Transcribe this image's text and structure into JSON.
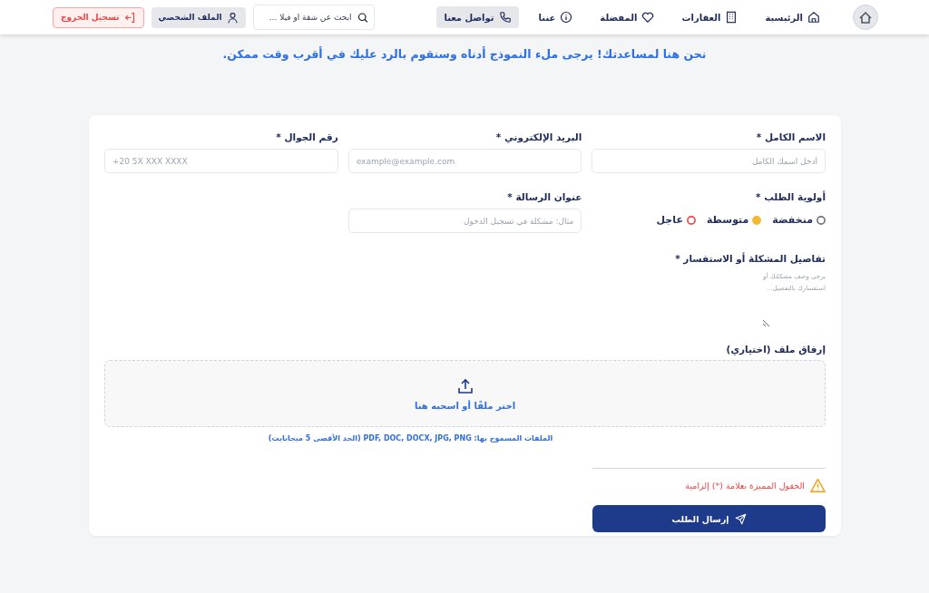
{
  "navbar": {
    "nav_items": [
      {
        "kind": "home",
        "label": "الرئيسية",
        "selected": false
      },
      {
        "kind": "building",
        "label": "العقارات",
        "selected": false
      },
      {
        "kind": "heart",
        "label": "المفضلة",
        "selected": false
      },
      {
        "kind": "info",
        "label": "عننا",
        "selected": false
      },
      {
        "kind": "phone",
        "label": "تواصل معنا",
        "selected": true
      }
    ],
    "search": {
      "placeholder": "ابحث عن شقة او فيلا ..."
    },
    "profile_button": "الملف الشخصي",
    "logout_button": "تسجيل الخروج"
  },
  "subtitle": "نحن هنا لمساعدتك! يرجى ملء النموذج أدناه وسنقوم بالرد عليك في أقرب وقت ممكن.",
  "form": {
    "fields": [
      {
        "label": "الاسم الكامل *",
        "placeholder": "أدخل اسمك الكامل",
        "ltr": false
      },
      {
        "label": "البريد الإلكتروني *",
        "placeholder": "example@example.com",
        "ltr": true
      },
      {
        "label": "رقم الجوال *",
        "placeholder": "+20 5X XXX XXXX",
        "ltr": true
      }
    ],
    "priority": {
      "label": "أولوية الطلب *",
      "options": [
        {
          "label": "منخفضة",
          "selected": false,
          "color": "#6b7280"
        },
        {
          "label": "متوسطة",
          "selected": true,
          "color": "#f5b82e"
        },
        {
          "label": "عاجل",
          "selected": false,
          "color": "#ef4444"
        }
      ]
    },
    "subject": {
      "label": "عنوان الرسالة *",
      "placeholder": "مثال: مشكلة في تسجيل الدخول"
    },
    "details": {
      "label": "تفاصيل المشكلة أو الاستفسار *",
      "placeholder": "يرجى وصف مشكلتك أو استفسارك بالتفصيل..."
    },
    "attachment": {
      "label": "إرفاق ملف (اختياري)",
      "dropzone_text": "اختر ملفًا أو اسحبه هنا",
      "hint": "الملفات المسموح بها: PDF, DOC, DOCX, JPG, PNG (الحد الأقصى 5 ميجابايت)"
    },
    "required_note": "الحقول المميزة بعلامة (*) إلزامية",
    "submit_button": "إرسال الطلب"
  }
}
